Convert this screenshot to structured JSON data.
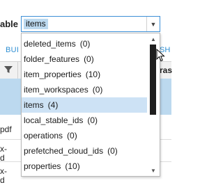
{
  "background": {
    "field_label": "able",
    "tab_left": "BUI",
    "tab_right": "SH",
    "col_header_right": "ras",
    "cells": [
      "pdf",
      "x-",
      "d",
      "x-",
      "d"
    ]
  },
  "combo": {
    "value": "items"
  },
  "dropdown": {
    "items": [
      {
        "label": "deleted_items",
        "count": "(0)"
      },
      {
        "label": "folder_features",
        "count": "(0)"
      },
      {
        "label": "item_properties",
        "count": "(10)"
      },
      {
        "label": "item_workspaces",
        "count": "(0)"
      },
      {
        "label": "items",
        "count": "(4)"
      },
      {
        "label": "local_stable_ids",
        "count": "(0)"
      },
      {
        "label": "operations",
        "count": "(0)"
      },
      {
        "label": "prefetched_cloud_ids",
        "count": "(0)"
      },
      {
        "label": "properties",
        "count": "(10)"
      }
    ],
    "selected_index": 4
  },
  "icons": {
    "combo_arrow": "chevron-down-icon",
    "scroll_up": "triangle-up-icon",
    "scroll_down": "triangle-down-icon",
    "filter": "filter-icon",
    "pointer": "mouse-pointer-icon"
  },
  "colors": {
    "accent": "#3c8fd6",
    "selection": "#cde2f5",
    "row_highlight": "#bcd9ef",
    "tab_text": "#2f8fd3"
  }
}
